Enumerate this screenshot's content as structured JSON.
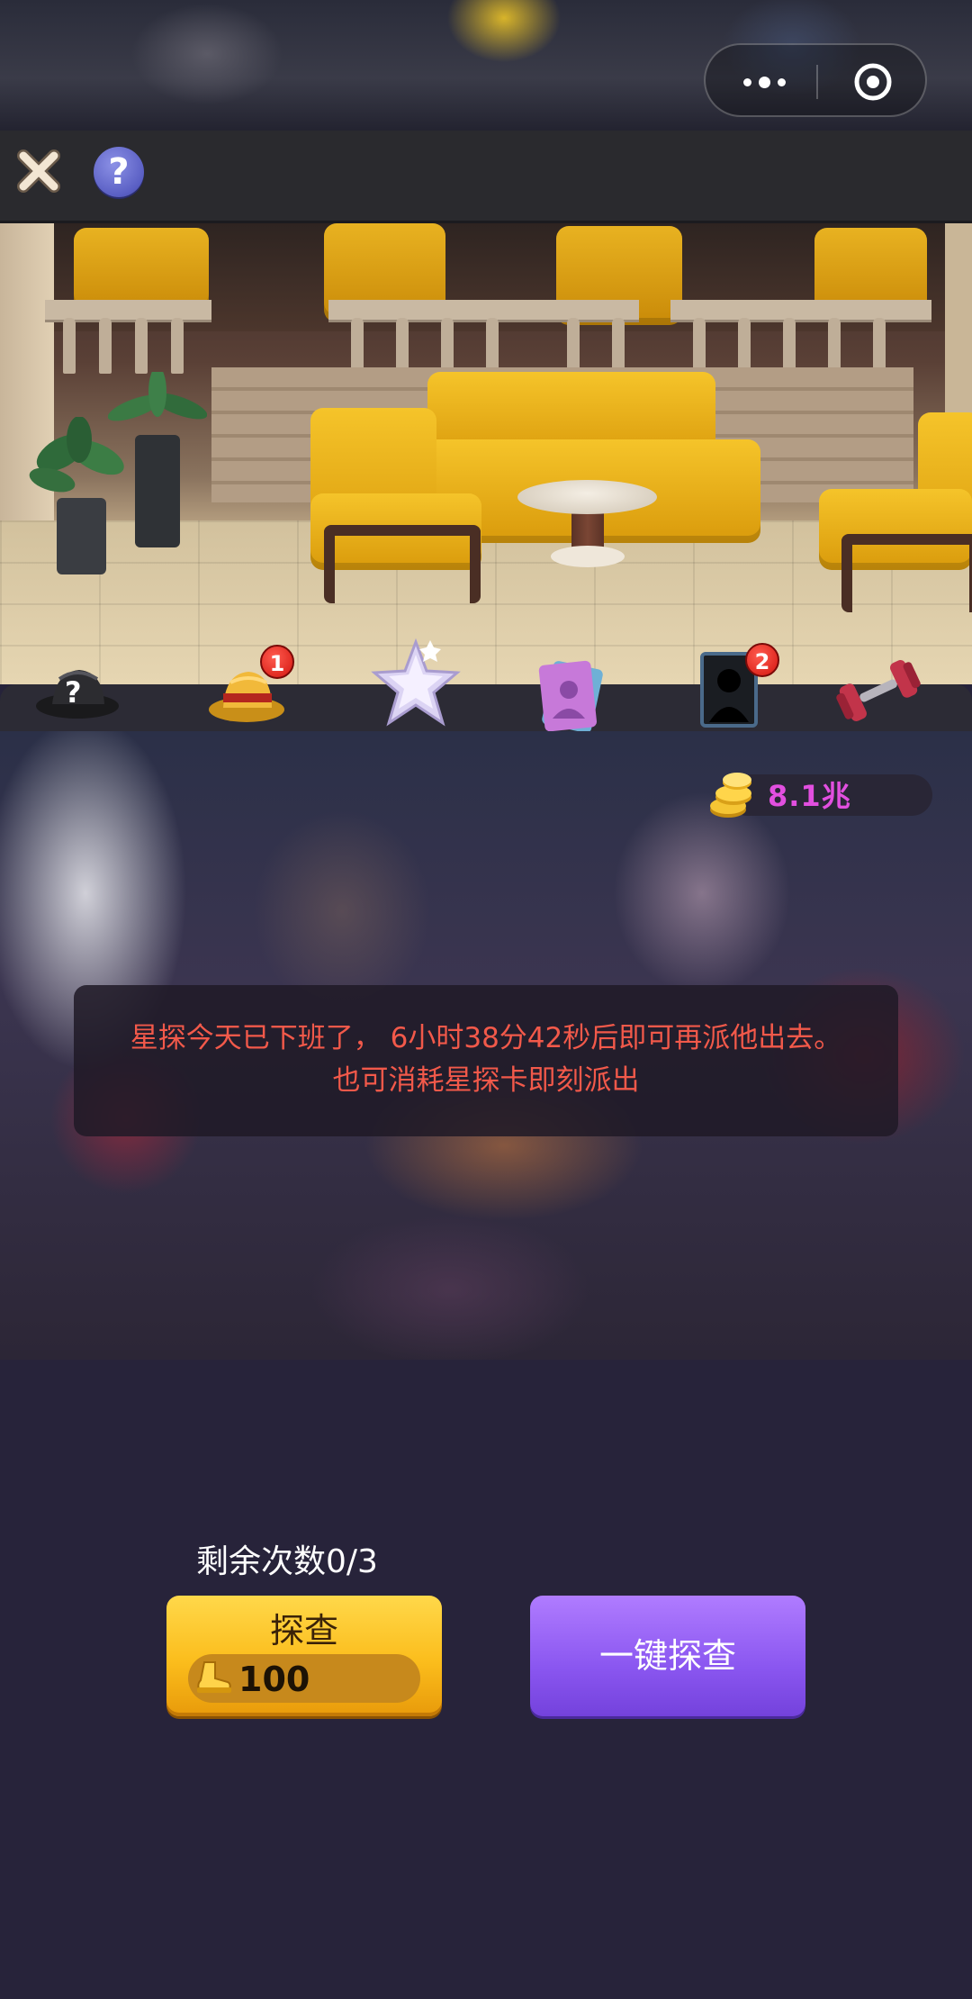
{
  "capsule": {
    "more_icon": "more-dots-icon",
    "close_icon": "target-circle-icon"
  },
  "toolbar": {
    "close_icon": "close-x-icon",
    "help_label": "?"
  },
  "icons": [
    {
      "name": "mystery-hat-icon",
      "badge": ""
    },
    {
      "name": "detective-hat-icon",
      "badge": "1"
    },
    {
      "name": "star-icon",
      "badge": ""
    },
    {
      "name": "photo-cards-icon",
      "badge": ""
    },
    {
      "name": "silhouette-card-icon",
      "badge": "2"
    },
    {
      "name": "dumbbell-icon",
      "badge": ""
    }
  ],
  "coins": {
    "value": "8.1兆",
    "icon": "coin-stack-icon"
  },
  "notice": {
    "line1": "星探今天已下班了， 6小时38分42秒后即可再派他出去。",
    "line2": "也可消耗星探卡即刻派出"
  },
  "actions": {
    "remaining": "剩余次数0/3",
    "probe_label": "探查",
    "probe_cost": "100",
    "cost_icon": "gold-boot-icon",
    "oneclick_label": "一键探查"
  },
  "colors": {
    "accent_gold": "#fbbd1c",
    "accent_purple": "#8a56f0",
    "notice_text": "#f2594a",
    "coin_text": "#e24fe0"
  }
}
